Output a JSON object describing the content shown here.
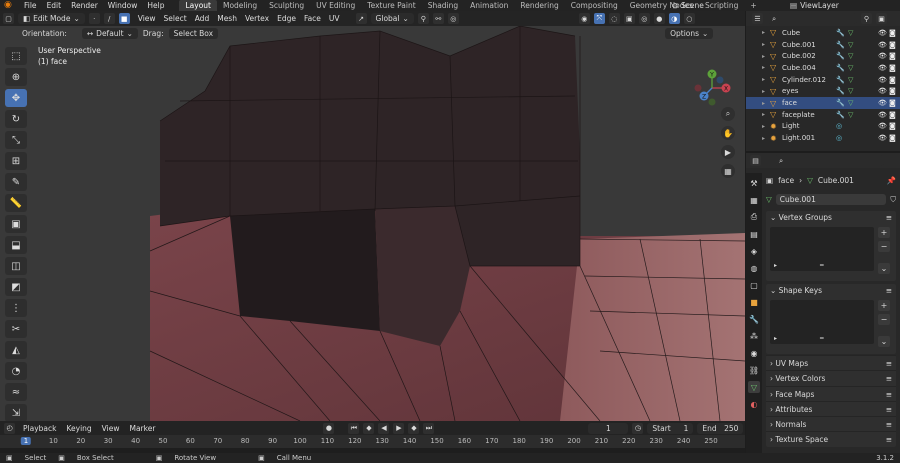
{
  "topbar": {
    "menus": [
      "File",
      "Edit",
      "Render",
      "Window",
      "Help"
    ],
    "workspaces": [
      "Layout",
      "Modeling",
      "Sculpting",
      "UV Editing",
      "Texture Paint",
      "Shading",
      "Animation",
      "Rendering",
      "Compositing",
      "Geometry Nodes",
      "Scripting"
    ],
    "active_workspace": "Layout",
    "add_tab": "+",
    "scene": "Scene",
    "view_layer": "ViewLayer"
  },
  "viewport": {
    "mode": "Edit Mode",
    "menus": [
      "View",
      "Select",
      "Add",
      "Mesh",
      "Vertex",
      "Edge",
      "Face",
      "UV"
    ],
    "transform_orientation": "Global",
    "orientation_label": "Orientation:",
    "orientation_value": "Default",
    "drag_label": "Drag:",
    "drag_value": "Select Box",
    "options_label": "Options",
    "overlay_line1": "User Perspective",
    "overlay_line2": "(1) face",
    "gizmo": {
      "x": "X",
      "y": "Y",
      "z": "Z"
    },
    "tool_icons": [
      "select-box-icon",
      "cursor-icon",
      "move-icon",
      "rotate-icon",
      "scale-icon",
      "transform-icon",
      "annotate-icon",
      "measure-icon",
      "add-cube-icon",
      "extrude-icon",
      "inset-icon",
      "bevel-icon",
      "loop-cut-icon",
      "knife-icon",
      "poly-build-icon",
      "spin-icon",
      "smooth-icon",
      "shrink-icon",
      "shear-icon",
      "rip-icon"
    ],
    "colors": {
      "accent": "#4772b3",
      "mesh": "#6e3f45",
      "mesh_dark": "#2b2224",
      "background": "#393939"
    }
  },
  "timeline": {
    "menus": [
      "Playback",
      "Keying",
      "View",
      "Marker"
    ],
    "current_frame": "1",
    "start_label": "Start",
    "start_value": "1",
    "end_label": "End",
    "end_value": "250",
    "frame_ticks": [
      "1",
      "10",
      "20",
      "30",
      "40",
      "50",
      "60",
      "70",
      "80",
      "90",
      "100",
      "110",
      "120",
      "130",
      "140",
      "150",
      "160",
      "170",
      "180",
      "190",
      "200",
      "210",
      "220",
      "230",
      "240",
      "250"
    ]
  },
  "statusbar": {
    "select": "Select",
    "box_select": "Box Select",
    "rotate_view": "Rotate View",
    "call_menu": "Call Menu",
    "version": "3.1.2"
  },
  "outliner": {
    "items": [
      {
        "name": "Cube",
        "selected": false,
        "type": "mesh"
      },
      {
        "name": "Cube.001",
        "selected": false,
        "type": "mesh"
      },
      {
        "name": "Cube.002",
        "selected": false,
        "type": "mesh"
      },
      {
        "name": "Cube.004",
        "selected": false,
        "type": "mesh"
      },
      {
        "name": "Cylinder.012",
        "selected": false,
        "type": "mesh"
      },
      {
        "name": "eyes",
        "selected": false,
        "type": "mesh"
      },
      {
        "name": "face",
        "selected": true,
        "type": "mesh"
      },
      {
        "name": "faceplate",
        "selected": false,
        "type": "mesh"
      },
      {
        "name": "Light",
        "selected": false,
        "type": "light"
      },
      {
        "name": "Light.001",
        "selected": false,
        "type": "light"
      }
    ]
  },
  "properties": {
    "object_name": "face",
    "mesh_name": "Cube.001",
    "mesh_field": "Cube.001",
    "vertex_groups": "Vertex Groups",
    "shape_keys": "Shape Keys",
    "collapsed_panels": [
      "UV Maps",
      "Vertex Colors",
      "Face Maps",
      "Attributes",
      "Normals",
      "Texture Space"
    ]
  }
}
